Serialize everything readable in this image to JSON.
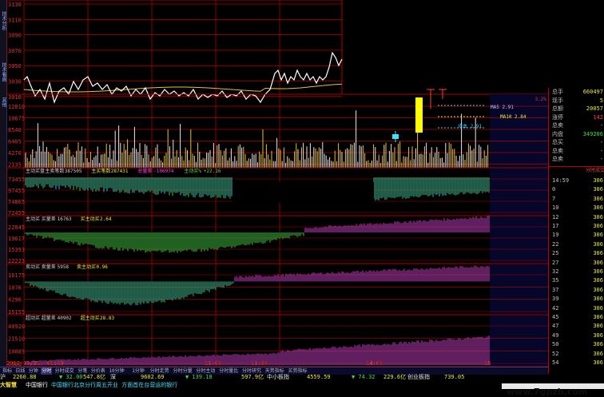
{
  "left_tabs": [
    "技术分析",
    "技术看盘",
    "其他"
  ],
  "price_axis": [
    "3130",
    "3110",
    "3090",
    "3070",
    "3050",
    "3030",
    "3010"
  ],
  "right_price_pct": "3.2%",
  "volume_axis": [
    "12810",
    "10675",
    "8540",
    "6405",
    "4270",
    "2135"
  ],
  "indicator_axis_main": [
    "73455",
    "97455",
    "74865",
    "72455"
  ],
  "indicator_axis_2": [
    "22845",
    "19617",
    "15393",
    "22223"
  ],
  "indicator_axis_3": [
    "16175",
    "1876",
    "4296",
    "15155"
  ],
  "indicator_axis_4": [
    "40920",
    "21510",
    "10885",
    "6000"
  ],
  "legends": {
    "main": [
      {
        "text": "主动买盘",
        "color": "#d0d0d0"
      },
      {
        "text": "主卖笔数",
        "color": "#d0d0d0"
      },
      {
        "text": "387505",
        "color": "#d0d0d0"
      },
      {
        "text": "主买笔数",
        "color": "#e8e840"
      },
      {
        "text": "287431",
        "color": "#e8e840"
      },
      {
        "text": "总量差",
        "color": "#ff40ff"
      },
      {
        "text": "-106974",
        "color": "#ff40ff"
      },
      {
        "text": "主动买%",
        "color": "#40e040"
      },
      {
        "text": "+22.16",
        "color": "#40e040"
      }
    ],
    "p2": [
      {
        "text": "主动买",
        "color": "#d0d0d0"
      },
      {
        "text": "买量差",
        "color": "#d0d0d0"
      },
      {
        "text": "16763",
        "color": "#d0d0d0"
      },
      {
        "text": "买主动买",
        "color": "#e8e840"
      },
      {
        "text": "2.64",
        "color": "#e8e840"
      }
    ],
    "p3": [
      {
        "text": "卖动买",
        "color": "#d0d0d0"
      },
      {
        "text": "卖量差",
        "color": "#d0d0d0"
      },
      {
        "text": "5958",
        "color": "#d0d0d0"
      },
      {
        "text": "卖主动买",
        "color": "#e8e840"
      },
      {
        "text": "0.96",
        "color": "#e8e840"
      }
    ],
    "p4": [
      {
        "text": "超动买",
        "color": "#d0d0d0"
      },
      {
        "text": "超量差",
        "color": "#d0d0d0"
      },
      {
        "text": "40902",
        "color": "#d0d0d0"
      },
      {
        "text": "超主动买",
        "color": "#e8e840"
      },
      {
        "text": "28.83",
        "color": "#e8e840"
      }
    ]
  },
  "annotations": [
    "MA5 2.91",
    "MA10 2.84",
    "成本 2.91"
  ],
  "time_axis": [
    "2012/06/21, 09:30",
    "11:00",
    "11:30",
    "14:00",
    "15"
  ],
  "quote_panel": [
    {
      "k": "总手",
      "v": "660497",
      "c": "#e8e840"
    },
    {
      "k": "现手",
      "v": "5",
      "c": "#e8e840"
    },
    {
      "k": "总额",
      "v": "20057",
      "c": "#e8e840"
    },
    {
      "k": "涨停",
      "v": "142",
      "c": "#ff4040"
    },
    {
      "k": "总卖",
      "v": "-",
      "c": "#c0c0c0"
    },
    {
      "k": "内盘",
      "v": "349206",
      "c": "#40e040"
    },
    {
      "k": "总买",
      "v": "-",
      "c": "#c0c0c0"
    },
    {
      "k": "总卖",
      "v": "-",
      "c": "#c0c0c0"
    },
    {
      "k": "总卖",
      "v": "-",
      "c": "#c0c0c0"
    }
  ],
  "ticks_header": "分时成交",
  "ticks": [
    {
      "t": "14:59",
      "p": "306"
    },
    {
      "t": "0",
      "p": "306"
    },
    {
      "t": "7",
      "p": "306"
    },
    {
      "t": "10",
      "p": "306"
    },
    {
      "t": "12",
      "p": "306"
    },
    {
      "t": "17",
      "p": "306"
    },
    {
      "t": "19",
      "p": "306"
    },
    {
      "t": "22",
      "p": "306"
    },
    {
      "t": "25",
      "p": "306"
    },
    {
      "t": "27",
      "p": "306"
    },
    {
      "t": "32",
      "p": "306"
    },
    {
      "t": "35",
      "p": "306"
    },
    {
      "t": "37",
      "p": "306"
    },
    {
      "t": "39",
      "p": "306"
    },
    {
      "t": "42",
      "p": "306"
    },
    {
      "t": "45",
      "p": "306"
    },
    {
      "t": "47",
      "p": "306"
    },
    {
      "t": "49",
      "p": "306"
    },
    {
      "t": "50",
      "p": "306"
    },
    {
      "t": "52",
      "p": "306"
    },
    {
      "t": "54",
      "p": "306"
    }
  ],
  "bottom_tabs": [
    "指标",
    "日线",
    "分钟",
    "分时",
    "分时成交",
    "分笔",
    "分价表",
    "10分钟",
    "1分钟",
    "分时走势",
    "分时分量",
    "分时主动",
    "分时量比",
    "分时研究",
    "天势指标",
    "买势指标"
  ],
  "status": {
    "brand": "大智慧",
    "stock": "中国银行",
    "news": "中国银行北京分行周五开业 方面首在台营运的银行",
    "idx1_name": "沪",
    "idx1_val": "2260.88",
    "idx1_chg": "32.00",
    "idx1_amt": "547.8亿",
    "idx2_name": "深",
    "idx2_val": "9602.69",
    "idx2_chg": "139.18",
    "idx2_amt": "597.9亿",
    "idx3_name": "中小板指",
    "idx3_val": "4559.59",
    "idx3_chg": "74.32",
    "idx3_amt": "229.6亿",
    "idx4_name": "创业板指",
    "idx4_val": "739.05"
  },
  "watermark": "www.7gpzb.com",
  "colors": {
    "grid": "#b00000",
    "up": "#ff4040",
    "down": "#40e040",
    "price": "#ffffff",
    "avg": "#e8c040",
    "cyan": "#40c8ff",
    "magenta": "#c040c0",
    "green": "#40c040",
    "yellow": "#e8e840"
  }
}
